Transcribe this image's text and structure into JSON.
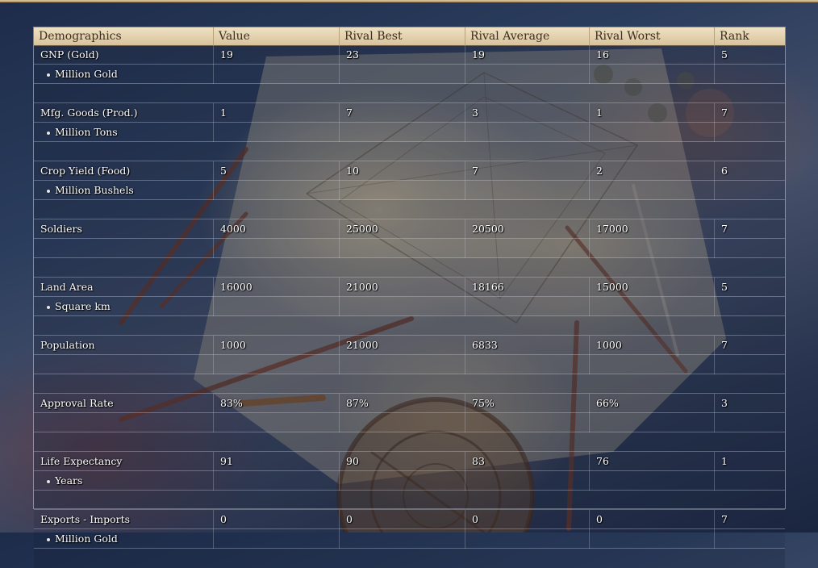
{
  "table": {
    "columns": [
      "Demographics",
      "Value",
      "Rival Best",
      "Rival Average",
      "Rival Worst",
      "Rank"
    ],
    "groups": [
      {
        "label": "GNP (Gold)",
        "values": [
          "19",
          "23",
          "19",
          "16",
          "5"
        ],
        "unit": "Million Gold"
      },
      {
        "label": "Mfg. Goods (Prod.)",
        "values": [
          "1",
          "7",
          "3",
          "1",
          "7"
        ],
        "unit": "Million Tons"
      },
      {
        "label": "Crop Yield (Food)",
        "values": [
          "5",
          "10",
          "7",
          "2",
          "6"
        ],
        "unit": "Million Bushels"
      },
      {
        "label": "Soldiers",
        "values": [
          "4000",
          "25000",
          "20500",
          "17000",
          "7"
        ],
        "unit": ""
      },
      {
        "label": "Land Area",
        "values": [
          "16000",
          "21000",
          "18166",
          "15000",
          "5"
        ],
        "unit": "Square km"
      },
      {
        "label": "Population",
        "values": [
          "1000",
          "21000",
          "6833",
          "1000",
          "7"
        ],
        "unit": ""
      },
      {
        "label": "Approval Rate",
        "values": [
          "83%",
          "87%",
          "75%",
          "66%",
          "3"
        ],
        "unit": ""
      },
      {
        "label": "Life Expectancy",
        "values": [
          "91",
          "90",
          "83",
          "76",
          "1"
        ],
        "unit": "Years"
      },
      {
        "label": "Exports - Imports",
        "values": [
          "0",
          "0",
          "0",
          "0",
          "7"
        ],
        "unit": "Million Gold"
      }
    ]
  },
  "colors": {
    "header_bg": "#e6d5b2",
    "header_text": "#3b2e1e",
    "cell_text": "#ffffff",
    "background_blue": "#2b3d5d"
  }
}
